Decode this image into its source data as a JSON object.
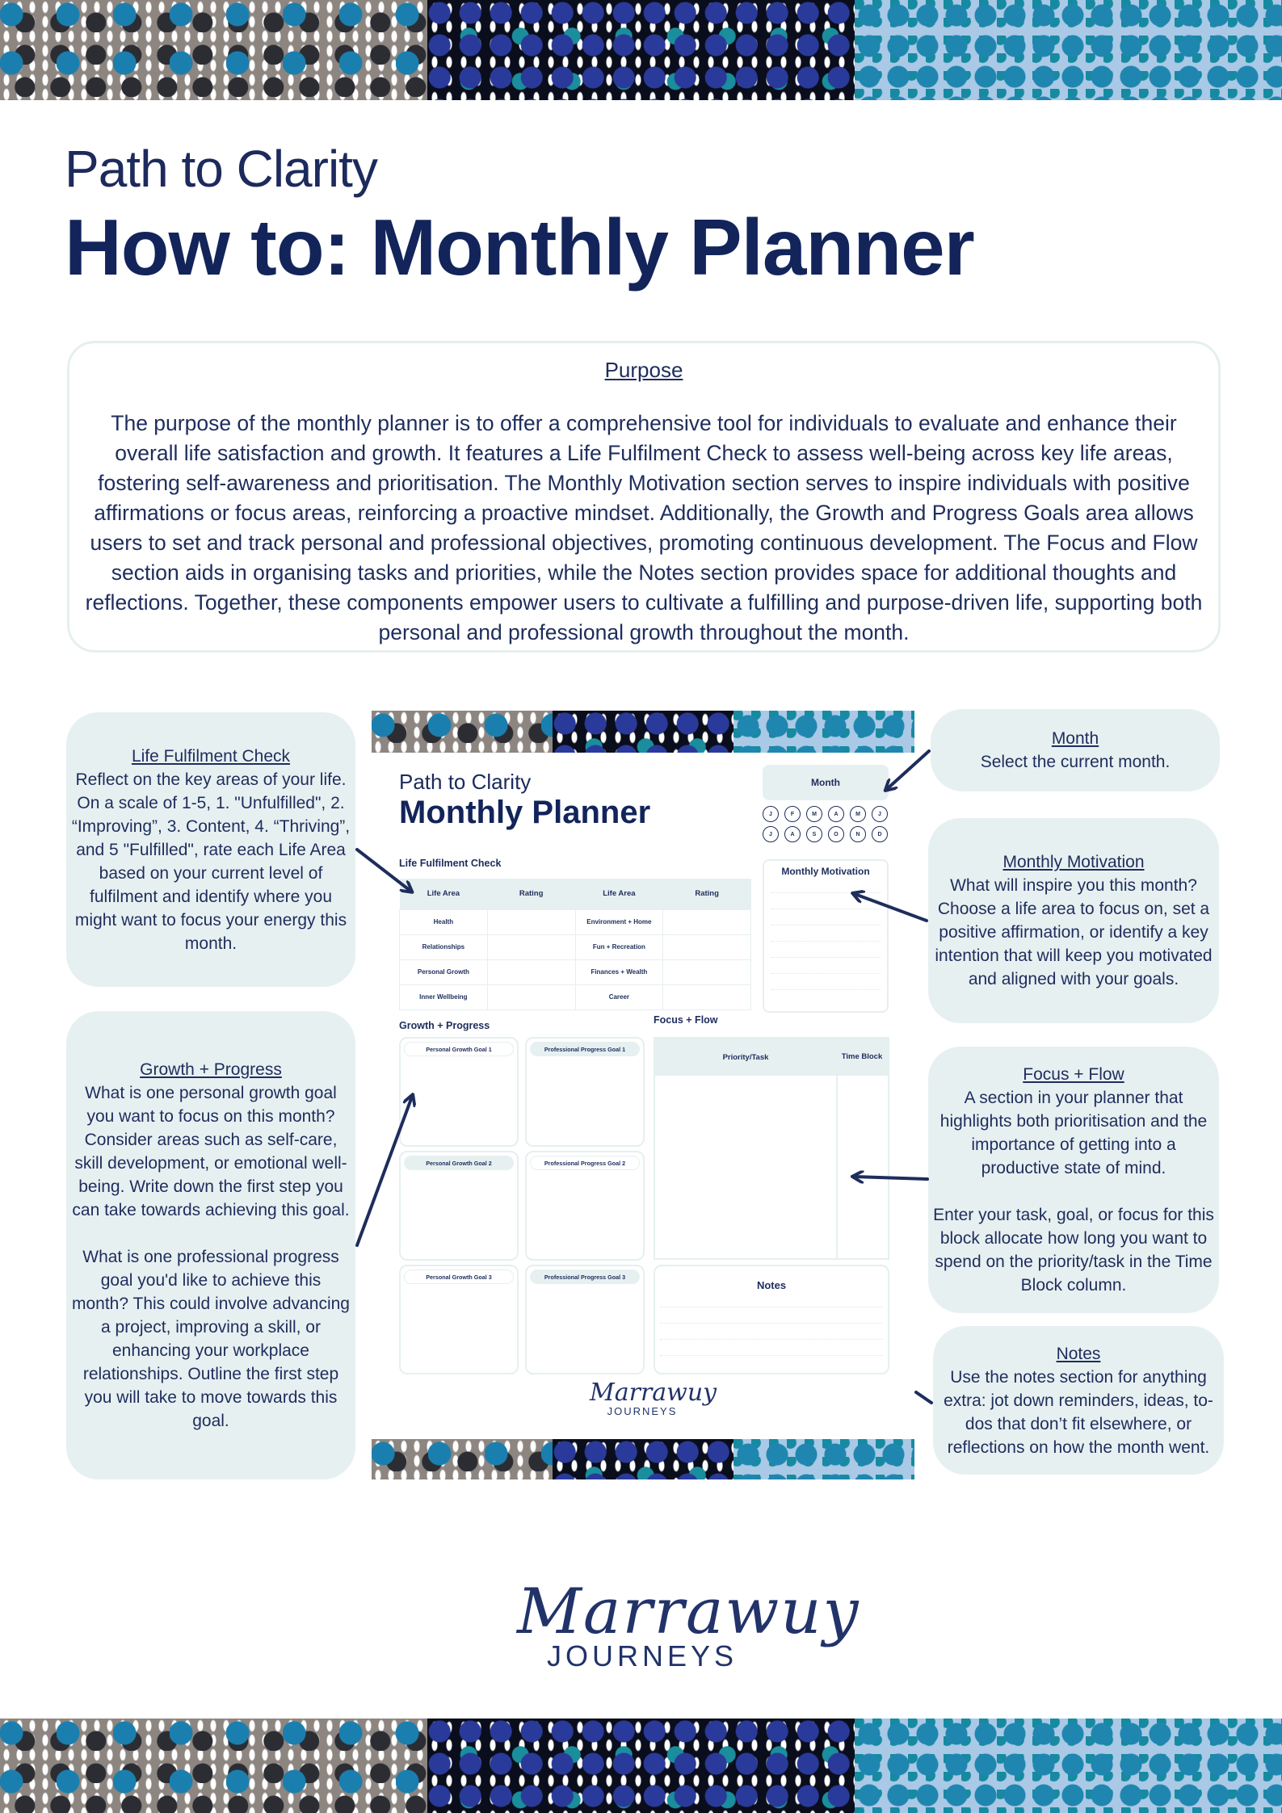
{
  "header": {
    "subtitle": "Path to Clarity",
    "title": "How to: Monthly Planner"
  },
  "purpose": {
    "heading": "Purpose",
    "body": "The purpose of the monthly planner is to offer a comprehensive tool for individuals to evaluate and enhance their overall life satisfaction and growth. It features a Life Fulfilment Check to assess well-being across key life areas, fostering self-awareness and prioritisation. The Monthly Motivation section serves to inspire individuals with positive affirmations or focus areas, reinforcing a proactive mindset. Additionally, the Growth and Progress Goals area allows users to set and track personal and professional objectives, promoting continuous development. The Focus and Flow section aids in organising tasks and priorities, while the Notes section provides space for additional thoughts and reflections. Together, these components empower users to cultivate a fulfilling and purpose-driven life, supporting both personal and professional growth throughout the month."
  },
  "callouts": {
    "life": {
      "title": "Life Fulfilment Check",
      "body": "Reflect on the key areas of your life. On a scale of 1-5, 1. \"Unfulfilled\", 2. “Improving”, 3. Content, 4. “Thriving”, and 5 \"Fulfilled\", rate each Life Area based on your current level of fulfilment and identify where you might want to focus your energy this month."
    },
    "growth": {
      "title": "Growth + Progress",
      "body": "What is one personal growth goal you want to focus on this month? Consider areas such as self-care, skill development, or emotional well-being. Write down the first step you can take towards achieving this goal.\n\nWhat is one professional progress goal you'd like to achieve this month? This could involve advancing a project, improving a skill, or enhancing your workplace relationships. Outline the first step you will take to move towards this goal."
    },
    "month": {
      "title": "Month",
      "body": "Select the current month."
    },
    "motivation": {
      "title": "Monthly Motivation",
      "body": "What will inspire you this month? Choose a life area to focus on, set a positive affirmation, or identify a key intention that will keep you motivated and aligned with your goals."
    },
    "focus": {
      "title": "Focus + Flow",
      "body": "A section in your planner that highlights both prioritisation and the importance of getting into a productive state of mind.\n\nEnter your task, goal, or focus for this block allocate how long you want to spend on the priority/task in the Time Block column."
    },
    "notes": {
      "title": "Notes",
      "body": "Use the notes section for anything extra: jot down reminders, ideas, to-dos that don’t fit elsewhere, or reflections on how the month went."
    }
  },
  "planner": {
    "subtitle": "Path to Clarity",
    "title": "Monthly Planner",
    "month_label": "Month",
    "months": [
      "J",
      "F",
      "M",
      "A",
      "M",
      "J",
      "J",
      "A",
      "S",
      "O",
      "N",
      "D"
    ],
    "life_check": {
      "heading": "Life Fulfilment Check",
      "columns": [
        "Life Area",
        "Rating",
        "Life Area",
        "Rating"
      ],
      "rows": [
        [
          "Health",
          "",
          "Environment + Home",
          ""
        ],
        [
          "Relationships",
          "",
          "Fun + Recreation",
          ""
        ],
        [
          "Personal Growth",
          "",
          "Finances + Wealth",
          ""
        ],
        [
          "Inner Wellbeing",
          "",
          "Career",
          ""
        ]
      ]
    },
    "motivation_heading": "Monthly Motivation",
    "growth_heading": "Growth + Progress",
    "goals": {
      "personal": [
        "Personal Growth Goal 1",
        "Personal Growth Goal 2",
        "Personal Growth Goal 3"
      ],
      "professional": [
        "Professional Progress Goal 1",
        "Professional Progress Goal 2",
        "Professional Progress Goal 3"
      ]
    },
    "focus": {
      "heading": "Focus + Flow",
      "col_task": "Priority/Task",
      "col_time": "Time Block"
    },
    "notes_heading": "Notes",
    "logo_script": "Marrawuy",
    "logo_word": "JOURNEYS"
  },
  "footer": {
    "logo_script": "Marrawuy",
    "logo_word": "JOURNEYS"
  },
  "colors": {
    "navy": "#12245a",
    "text": "#1e2d5c",
    "callout_bg": "#e7f0f1",
    "border": "#e6efef"
  }
}
